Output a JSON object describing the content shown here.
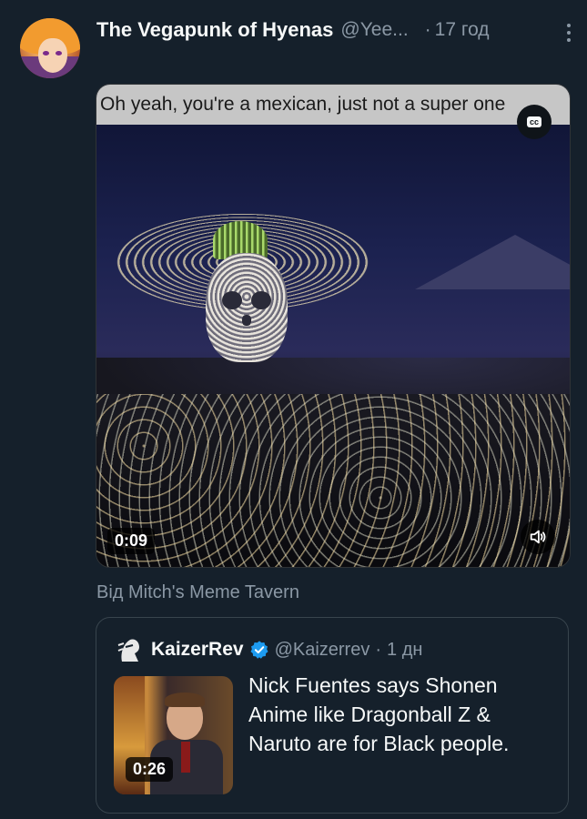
{
  "tweet": {
    "author_name": "The Vegapunk of Hyenas",
    "handle": "@Yee...",
    "separator": "·",
    "time": "17 год",
    "avatar_icon": "anime-avatar",
    "more_icon": "more-vertical-icon"
  },
  "video": {
    "caption": "Oh yeah, you're a mexican, just not a super one",
    "cc_label": "cc",
    "duration": "0:09",
    "volume_icon": "volume-icon"
  },
  "attribution": "Від Mitch's Meme Tavern",
  "quote": {
    "author_name": "KaizerRev",
    "verified_color": "#1d9bf0",
    "handle": "@Kaizerrev",
    "separator": "·",
    "time": "1 дн",
    "thumb_duration": "0:26",
    "text": "Nick Fuentes says Shonen Anime like Dragonball Z & Naruto are for Black people."
  },
  "colors": {
    "background": "#15202b",
    "secondary_text": "#8b98a5",
    "border": "#38444d"
  }
}
